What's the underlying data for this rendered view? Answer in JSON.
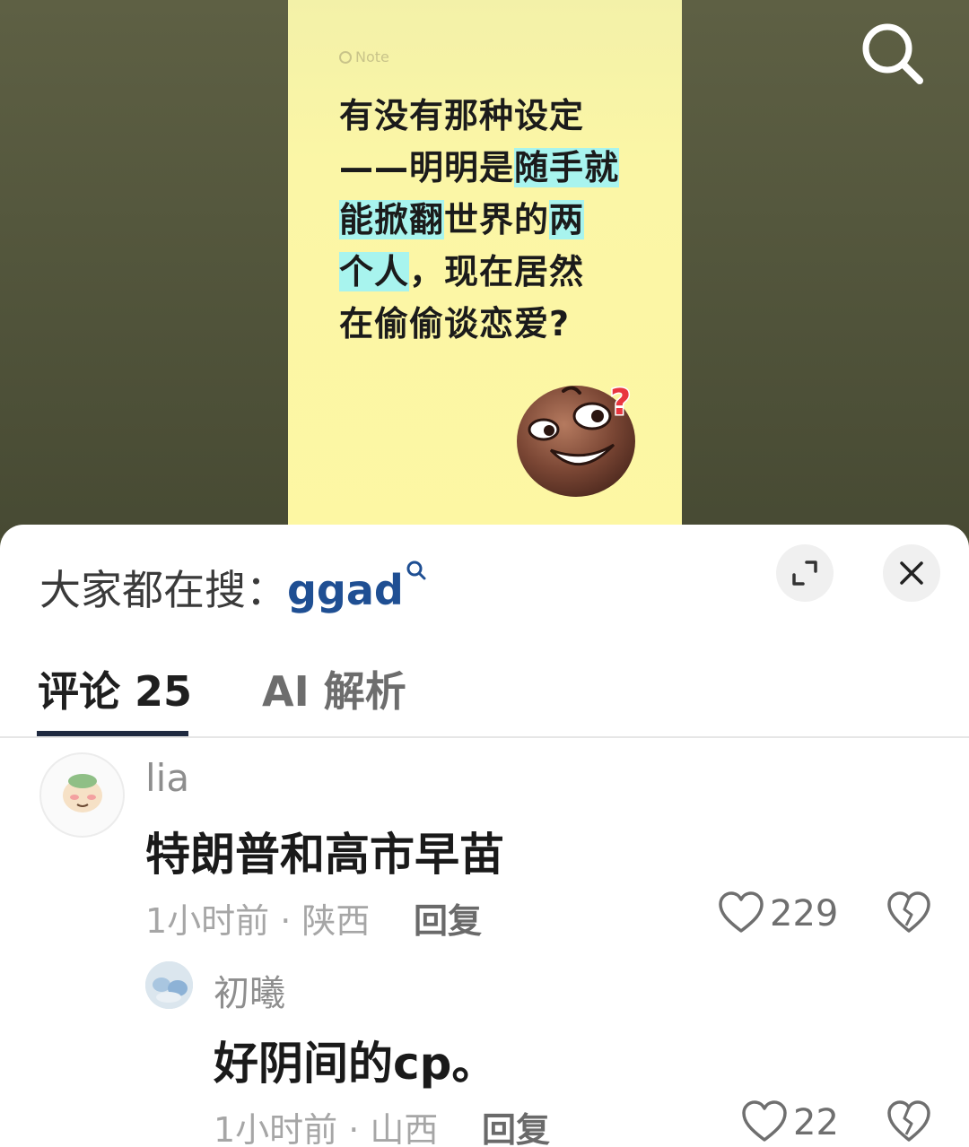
{
  "video": {
    "note_badge": "Note",
    "note_lines": [
      {
        "segments": [
          {
            "text": "有没有那种设定",
            "hl": false
          }
        ]
      },
      {
        "segments": [
          {
            "text": "——明明是",
            "hl": false
          },
          {
            "text": "随手就",
            "hl": true
          }
        ]
      },
      {
        "segments": [
          {
            "text": "能掀翻",
            "hl": true
          },
          {
            "text": "世界的",
            "hl": false
          },
          {
            "text": "两",
            "hl": true
          }
        ]
      },
      {
        "segments": [
          {
            "text": "个人",
            "hl": true
          },
          {
            "text": "，现在居然",
            "hl": false
          }
        ]
      },
      {
        "segments": [
          {
            "text": "在偷偷谈恋爱?",
            "hl": false
          }
        ]
      }
    ]
  },
  "sheet": {
    "hot_search_prefix": "大家都在搜：",
    "hot_search_keyword": "ggad"
  },
  "tabs": [
    {
      "label": "评论 25",
      "active": true
    },
    {
      "label": "AI 解析",
      "active": false
    }
  ],
  "comments": [
    {
      "username": "lia",
      "text": "特朗普和高市早苗",
      "meta": "1小时前 · 陕西",
      "reply_label": "回复",
      "likes": "229"
    },
    {
      "username": "初曦",
      "text": "好阴间的cp。",
      "meta": "1小时前 · 山西",
      "reply_label": "回复",
      "likes": "22"
    }
  ],
  "colors": {
    "note_bg": "#fdf7a3",
    "highlight": "#a8f4ee",
    "keyword": "#1f4f93",
    "active_tab": "#1f2a40"
  }
}
